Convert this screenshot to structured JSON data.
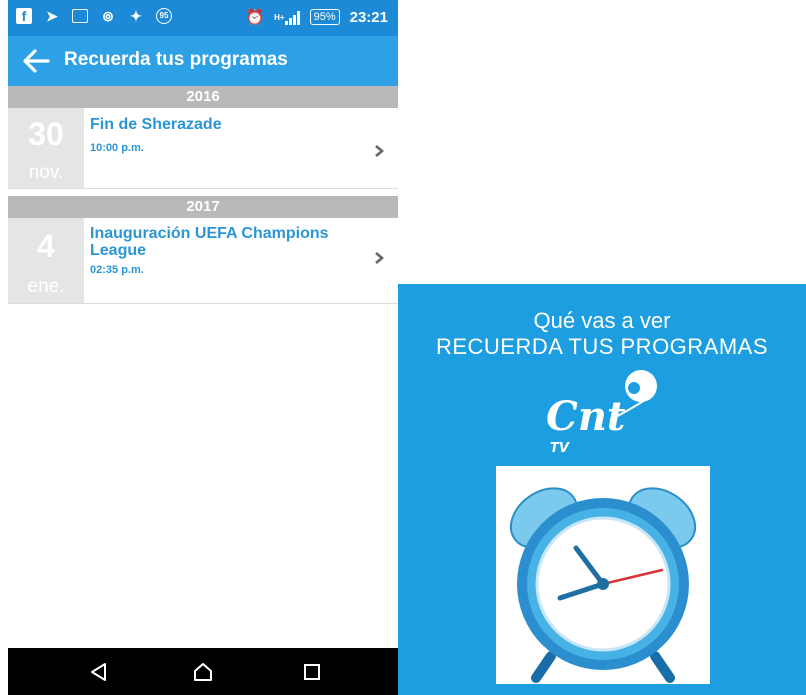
{
  "status_bar": {
    "time": "23:21",
    "battery": "95%",
    "notif_badge": "95",
    "network": "H+"
  },
  "app_bar": {
    "title": "Recuerda tus programas"
  },
  "sections": [
    {
      "year": "2016",
      "events": [
        {
          "day": "30",
          "month": "nov.",
          "title": "Fin de Sherazade",
          "time": "10:00 p.m."
        }
      ]
    },
    {
      "year": "2017",
      "events": [
        {
          "day": "4",
          "month": "ene.",
          "title": "Inauguración UEFA Champions League",
          "time": "02:35 p.m."
        }
      ]
    }
  ],
  "promo": {
    "line1": "Qué vas a ver",
    "line2": "RECUERDA TUS PROGRAMAS",
    "logo_text": "Cnt",
    "logo_sub": "TV"
  },
  "icons": {
    "back": "arrow-left-icon",
    "chevron": "chevron-right-icon",
    "nav_back": "triangle-back-icon",
    "nav_home": "home-outline-icon",
    "nav_recents": "square-recents-icon"
  },
  "colors": {
    "status_bar": "#1c8ad6",
    "app_bar": "#2ea0e6",
    "accent_text": "#2b95d6",
    "year_bar": "#b9b9b9",
    "date_box": "#e5e5e5",
    "promo_bg": "#1c9ee0"
  }
}
